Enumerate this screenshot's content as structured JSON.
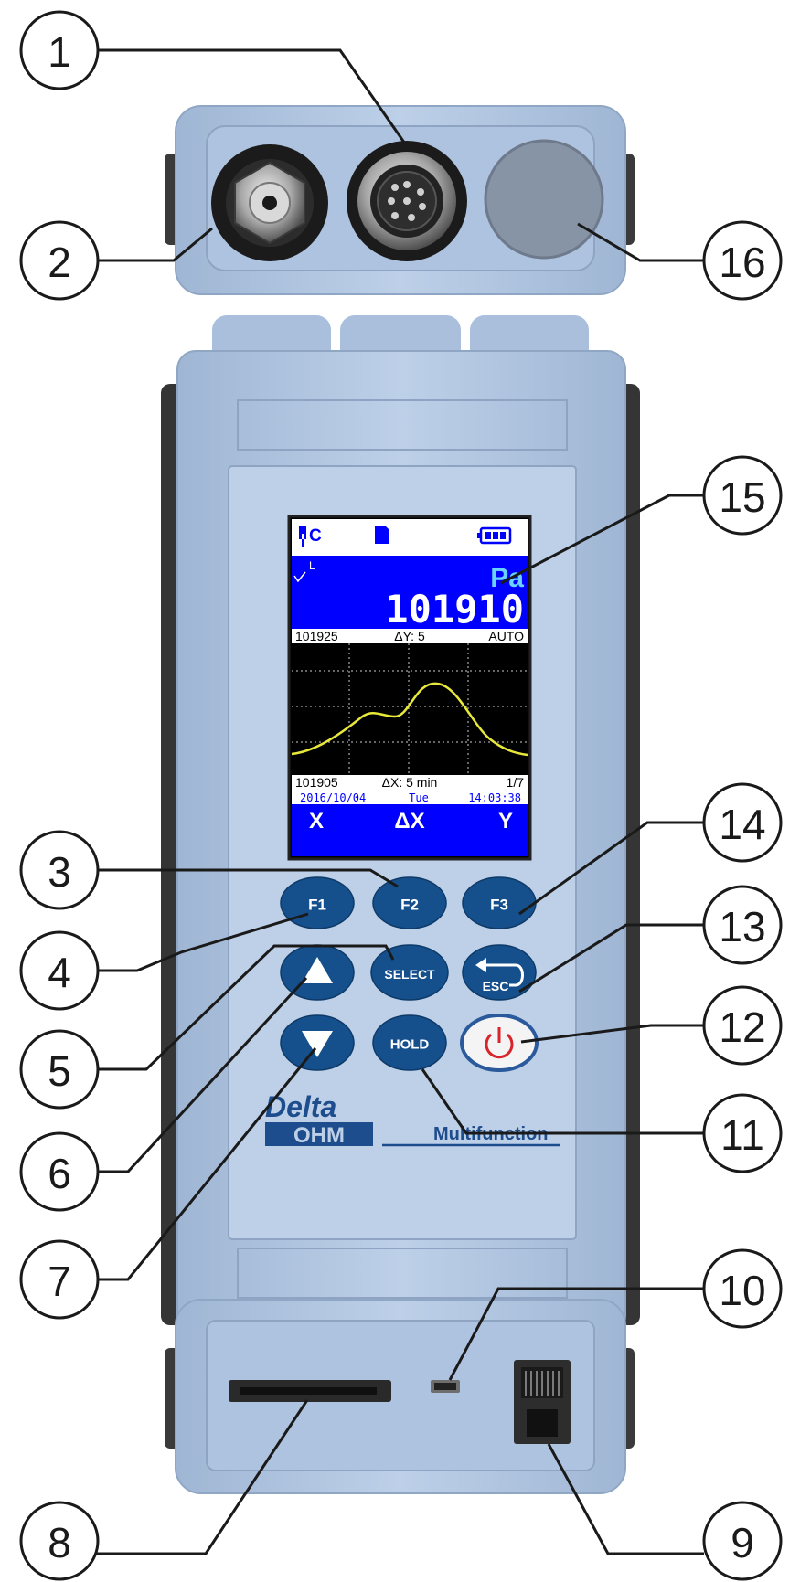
{
  "device": {
    "screen": {
      "status_icons": [
        "plug-c-icon",
        "sd-card-icon",
        "battery-icon"
      ],
      "status_c": "C",
      "unit": "Pa",
      "corner_l": "L",
      "reading": "101910",
      "graph_top": {
        "left": "101925",
        "center": "ΔY: 5",
        "right": "AUTO"
      },
      "graph_bottom": {
        "left": "101905",
        "center": "ΔX: 5 min",
        "right": "1/7"
      },
      "datetime": {
        "date": "2016/10/04",
        "day": "Tue",
        "time": "14:03:38"
      },
      "softkeys": [
        "X",
        "ΔX",
        "Y"
      ]
    },
    "keys": {
      "f1": "F1",
      "f2": "F2",
      "f3": "F3",
      "select": "SELECT",
      "esc": "ESC",
      "hold": "HOLD"
    },
    "brand": {
      "delta": "Delta",
      "ohm": "OHM",
      "tagline": "Multifunction"
    },
    "colors": {
      "body": "#b4c9e4",
      "screen_blue": "#0000ff",
      "key_blue": "#15508c",
      "power_red": "#d8242b",
      "graph_line": "#e8e83a"
    }
  },
  "callouts": [
    "1",
    "2",
    "3",
    "4",
    "5",
    "6",
    "7",
    "8",
    "9",
    "10",
    "11",
    "12",
    "13",
    "14",
    "15",
    "16"
  ]
}
